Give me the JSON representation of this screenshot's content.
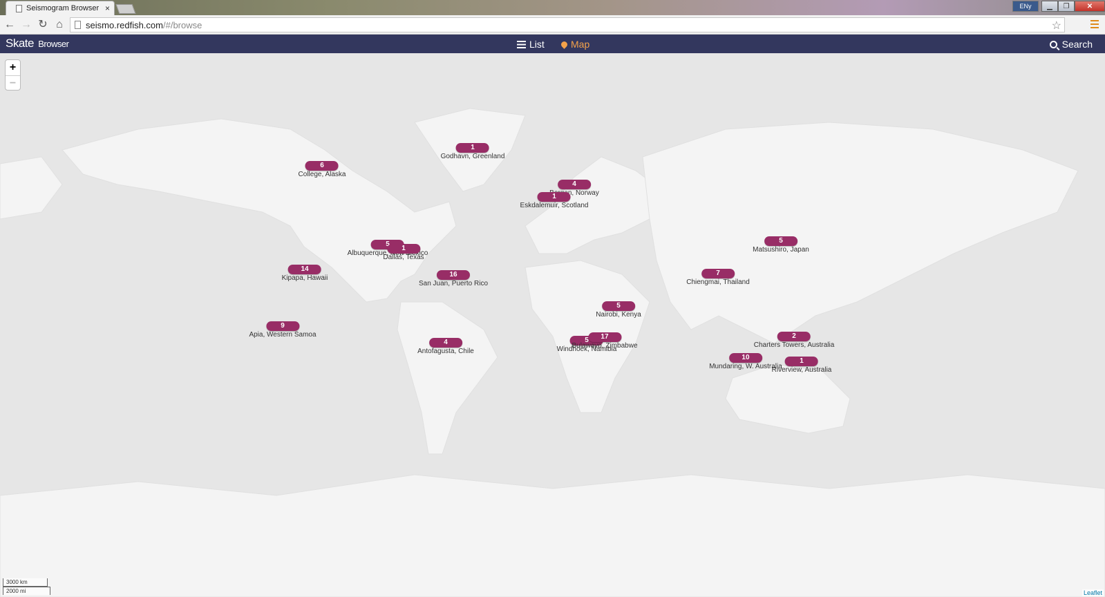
{
  "browser": {
    "tab_title": "Seismogram Browser",
    "tab_close": "×",
    "url_host": "seismo.redfish.com",
    "url_path": "/#/browse",
    "lang_badge": "ENy"
  },
  "app": {
    "brand_main": "Skate",
    "brand_sub": "Browser",
    "nav": {
      "list": "List",
      "map": "Map",
      "search": "Search"
    },
    "colors": {
      "navbar": "#33375e",
      "active_link": "#f4a24a",
      "marker": "#982d66"
    }
  },
  "map": {
    "zoom_in": "+",
    "zoom_out": "−",
    "scale_km": "3000 km",
    "scale_mi": "2000 mi",
    "attribution": "Leaflet",
    "markers": [
      {
        "count": "1",
        "label": "Godhavn, Greenland"
      },
      {
        "count": "6",
        "label": "College, Alaska"
      },
      {
        "count": "4",
        "label": "Bergen, Norway"
      },
      {
        "count": "1",
        "label": "Eskdalemuir, Scotland"
      },
      {
        "count": "5",
        "label": "Albuquerque, New Mexico"
      },
      {
        "count": "1",
        "label": "Dallas, Texas"
      },
      {
        "count": "14",
        "label": "Kipapa, Hawaii"
      },
      {
        "count": "16",
        "label": "San Juan, Puerto Rico"
      },
      {
        "count": "5",
        "label": "Matsushiro, Japan"
      },
      {
        "count": "7",
        "label": "Chiengmai, Thailand"
      },
      {
        "count": "5",
        "label": "Nairobi, Kenya"
      },
      {
        "count": "9",
        "label": "Apia, Western Samoa"
      },
      {
        "count": "4",
        "label": "Antofagusta, Chile"
      },
      {
        "count": "5",
        "label": "Windhoek, Namibia"
      },
      {
        "count": "17",
        "label": "Bulawayo, Zimbabwe"
      },
      {
        "count": "2",
        "label": "Charters Towers, Australia"
      },
      {
        "count": "10",
        "label": "Mundaring, W. Australia"
      },
      {
        "count": "1",
        "label": "Riverview, Australia"
      }
    ]
  }
}
